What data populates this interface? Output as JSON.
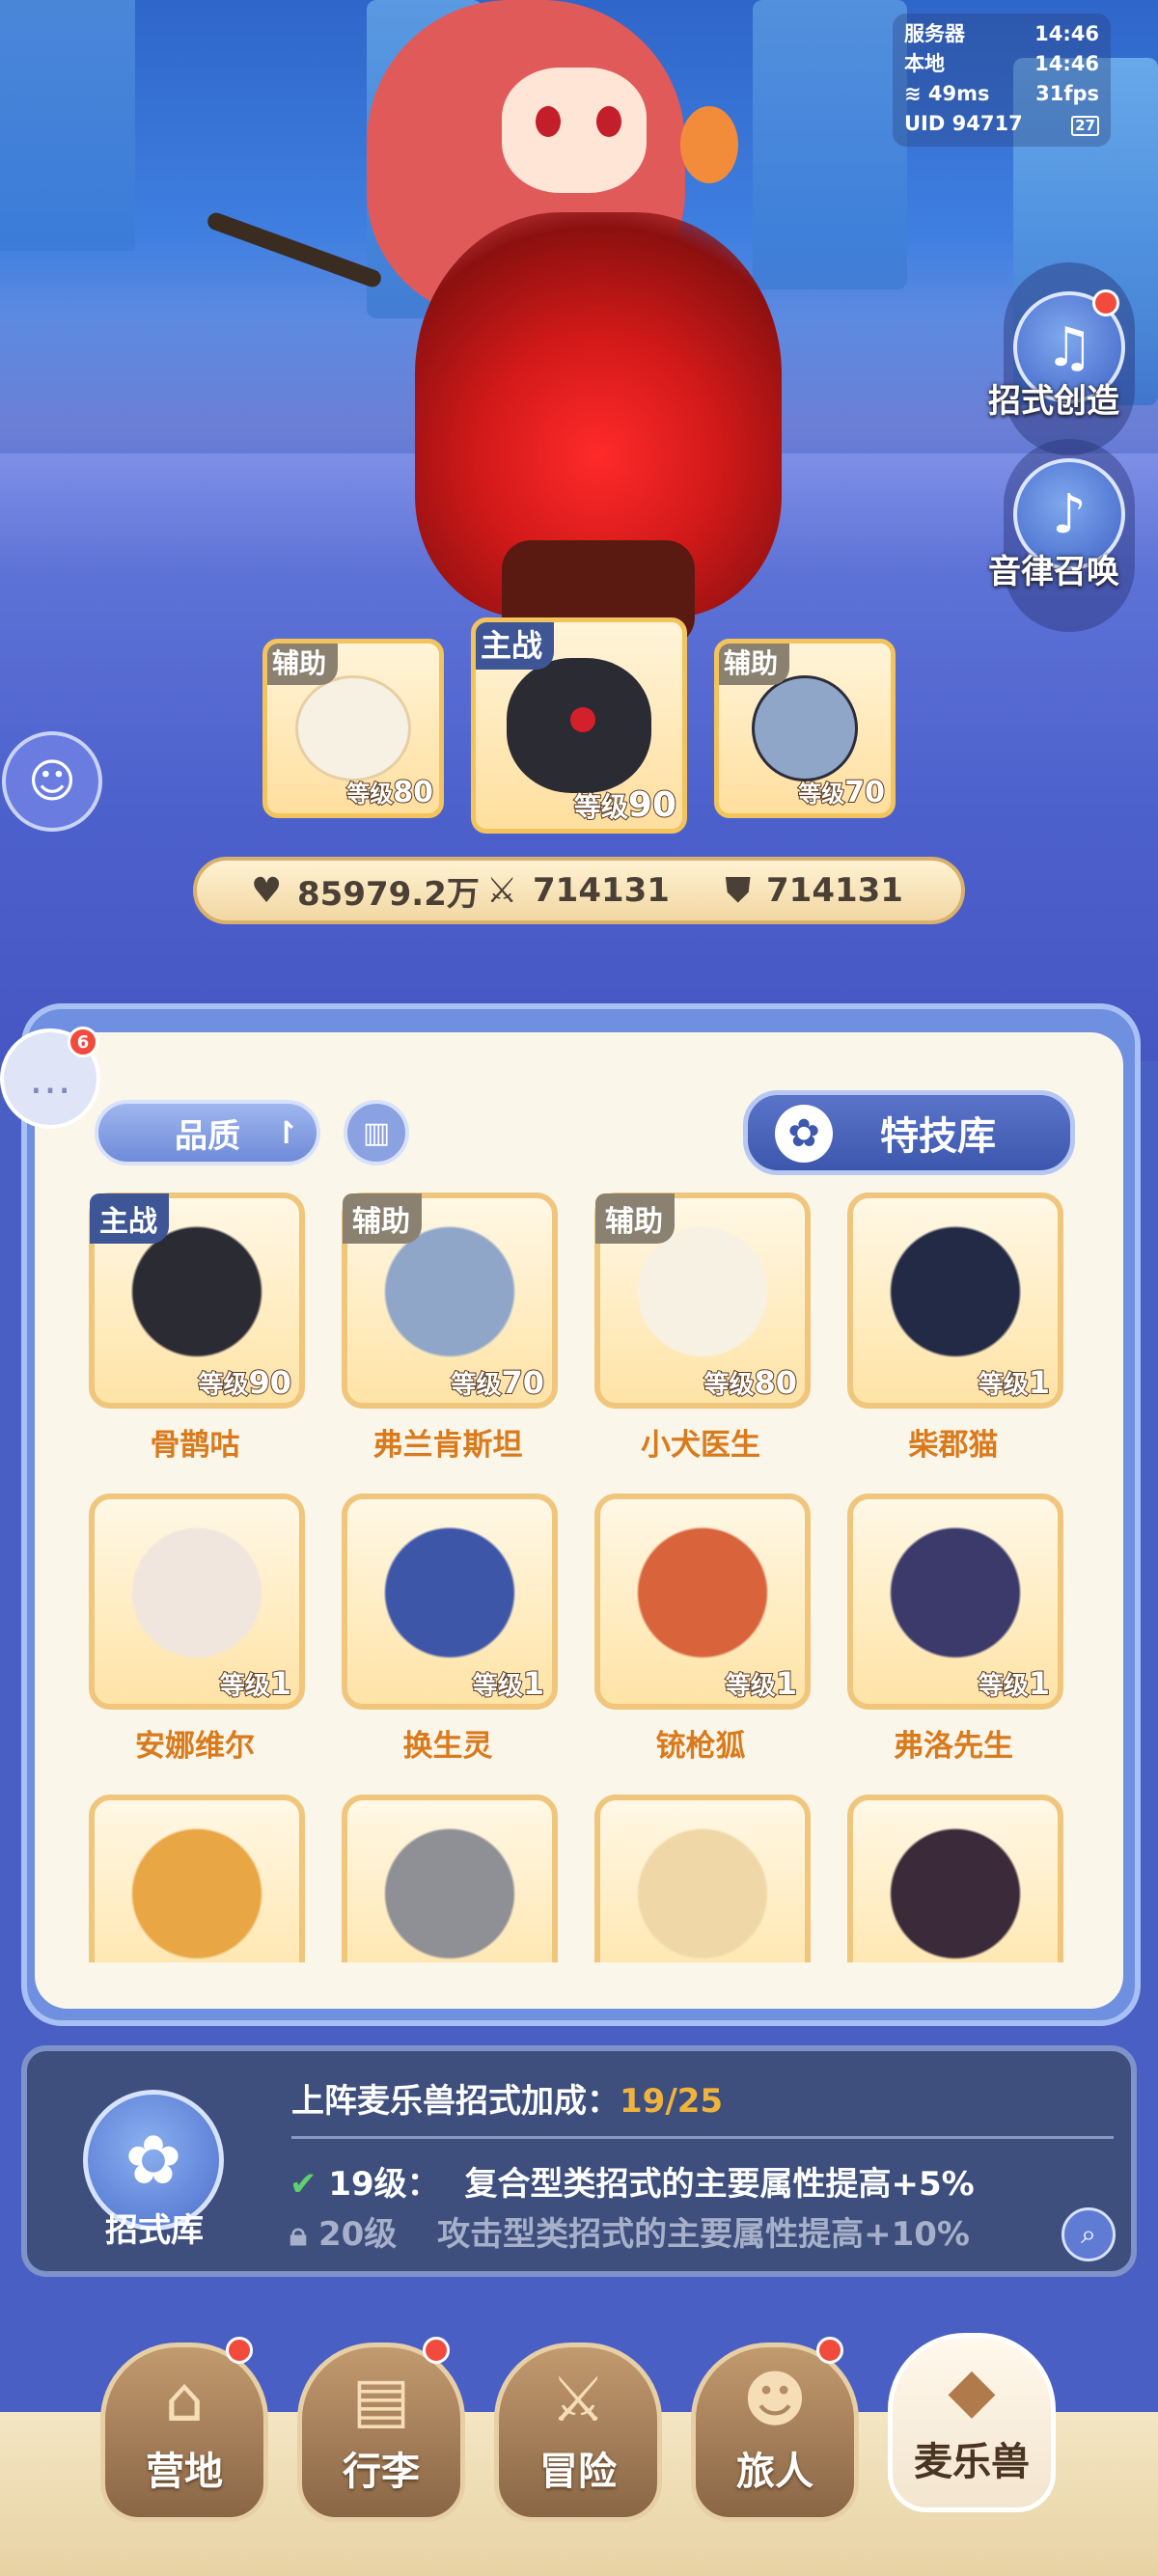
{
  "status": {
    "server_label": "服务器",
    "server_time": "14:46",
    "local_label": "本地",
    "local_time": "14:46",
    "ping": "49ms",
    "fps": "31fps",
    "uid_label": "UID",
    "uid": "94717",
    "battery": "27"
  },
  "side": {
    "create_label": "招式创造",
    "summon_label": "音律召唤"
  },
  "team": [
    {
      "role": "辅助",
      "level_label": "等级",
      "level": "80",
      "name_key": "小犬医生"
    },
    {
      "role": "主战",
      "level_label": "等级",
      "level": "90",
      "name_key": "骨鹊咕"
    },
    {
      "role": "辅助",
      "level_label": "等级",
      "level": "70",
      "name_key": "弗兰肯斯坦"
    }
  ],
  "stats": {
    "hp": "85979.2万",
    "atk": "714131",
    "def": "714131"
  },
  "chat": {
    "badge": "6"
  },
  "filters": {
    "quality_label": "品质",
    "skill_lib_label": "特技库"
  },
  "monsters": [
    {
      "name": "骨鹊咕",
      "tag": "主战",
      "level_label": "等级",
      "level": "90",
      "color": "#2b2b33"
    },
    {
      "name": "弗兰肯斯坦",
      "tag": "辅助",
      "level_label": "等级",
      "level": "70",
      "color": "#8fa6c9"
    },
    {
      "name": "小犬医生",
      "tag": "辅助",
      "level_label": "等级",
      "level": "80",
      "color": "#f7f1e4"
    },
    {
      "name": "柴郡猫",
      "tag": "",
      "level_label": "等级",
      "level": "1",
      "color": "#232a45"
    },
    {
      "name": "安娜维尔",
      "tag": "",
      "level_label": "等级",
      "level": "1",
      "color": "#f0e6de"
    },
    {
      "name": "换生灵",
      "tag": "",
      "level_label": "等级",
      "level": "1",
      "color": "#3e56a8"
    },
    {
      "name": "铳枪狐",
      "tag": "",
      "level_label": "等级",
      "level": "1",
      "color": "#d9633a"
    },
    {
      "name": "弗洛先生",
      "tag": "",
      "level_label": "等级",
      "level": "1",
      "color": "#3b3a6a"
    },
    {
      "name": "",
      "tag": "",
      "level_label": "",
      "level": "",
      "color": "#e8a645"
    },
    {
      "name": "",
      "tag": "",
      "level_label": "",
      "level": "",
      "color": "#8f8f96"
    },
    {
      "name": "",
      "tag": "",
      "level_label": "",
      "level": "",
      "color": "#efd7a8"
    },
    {
      "name": "",
      "tag": "",
      "level_label": "",
      "level": "",
      "color": "#3a2a3a"
    }
  ],
  "bonus": {
    "lib_label": "招式库",
    "title": "上阵麦乐兽招式加成：",
    "progress": "19/25",
    "row1_level": "19级：",
    "row1_text": "复合型类招式的主要属性提高+5%",
    "row2_level": "20级",
    "row2_text": "攻击型类招式的主要属性提高+10%"
  },
  "nav": [
    {
      "label": "营地",
      "badge": true
    },
    {
      "label": "行李",
      "badge": true
    },
    {
      "label": "冒险",
      "badge": false
    },
    {
      "label": "旅人",
      "badge": true
    },
    {
      "label": "麦乐兽",
      "badge": false,
      "active": true
    }
  ]
}
